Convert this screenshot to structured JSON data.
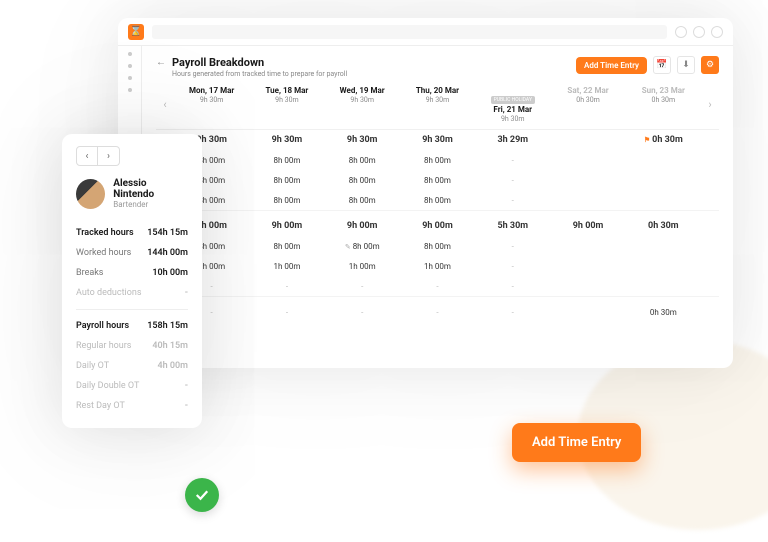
{
  "header": {
    "title": "Payroll Breakdown",
    "subtitle": "Hours generated from tracked time to prepare for payroll",
    "addBtn": "Add Time Entry"
  },
  "days": [
    {
      "label": "Mon, 17 Mar",
      "total": "9h 30m"
    },
    {
      "label": "Tue, 18 Mar",
      "total": "9h 30m"
    },
    {
      "label": "Wed, 19 Mar",
      "total": "9h 30m"
    },
    {
      "label": "Thu, 20 Mar",
      "total": "9h 30m"
    },
    {
      "label": "Fri, 21 Mar",
      "total": "9h 30m",
      "chip": "PUBLIC HOLIDAY"
    },
    {
      "label": "Sat, 22 Mar",
      "total": "0h 30m",
      "wend": true
    },
    {
      "label": "Sun, 23 Mar",
      "total": "0h 30m",
      "wend": true
    }
  ],
  "rows": [
    {
      "bold": true,
      "c": [
        "9h 30m",
        "9h 30m",
        "9h 30m",
        "9h 30m",
        "3h 29m",
        "",
        "0h 30m"
      ],
      "icon": [
        false,
        false,
        false,
        false,
        false,
        false,
        true
      ]
    },
    {
      "c": [
        "8h 00m",
        "8h 00m",
        "8h 00m",
        "8h 00m",
        "-",
        "",
        ""
      ]
    },
    {
      "c": [
        "8h 00m",
        "8h 00m",
        "8h 00m",
        "8h 00m",
        "-",
        "",
        ""
      ]
    },
    {
      "c": [
        "8h 00m",
        "8h 00m",
        "8h 00m",
        "8h 00m",
        "-",
        "",
        ""
      ]
    },
    {
      "sep": true
    },
    {
      "bold": true,
      "c": [
        "9h 00m",
        "9h 00m",
        "9h 00m",
        "9h 00m",
        "5h 30m",
        "9h 00m",
        "0h 30m"
      ]
    },
    {
      "c": [
        "8h 00m",
        "8h 00m",
        "8h 00m",
        "8h 00m",
        "-",
        "",
        ""
      ],
      "pen": [
        false,
        false,
        true,
        false,
        false,
        false,
        false
      ]
    },
    {
      "c": [
        "1h 00m",
        "1h 00m",
        "1h 00m",
        "1h 00m",
        "-",
        "",
        ""
      ]
    },
    {
      "c": [
        "-",
        "-",
        "-",
        "-",
        "-",
        "",
        ""
      ]
    },
    {
      "sep": true
    },
    {
      "c": [
        "-",
        "-",
        "-",
        "-",
        "-",
        "",
        "0h 30m"
      ]
    }
  ],
  "emp": {
    "name": "Alessio Nintendo",
    "role": "Bartender"
  },
  "stats": [
    {
      "l": "Tracked hours",
      "v": "154h 15m",
      "maj": true
    },
    {
      "l": "Worked hours",
      "v": "144h 00m"
    },
    {
      "l": "Breaks",
      "v": "10h 00m"
    },
    {
      "l": "Auto deductions",
      "v": "-",
      "soft": true
    },
    {
      "hr": true
    },
    {
      "l": "Payroll hours",
      "v": "158h 15m",
      "maj": true
    },
    {
      "l": "Regular hours",
      "v": "40h 15m",
      "soft": true
    },
    {
      "l": "Daily OT",
      "v": "4h 00m",
      "soft": true
    },
    {
      "l": "Daily Double OT",
      "v": "-",
      "soft": true
    },
    {
      "l": "Rest Day OT",
      "v": "-",
      "soft": true
    }
  ],
  "float": "Add Time Entry",
  "icons": {
    "back": "←",
    "prev": "‹",
    "next": "›",
    "cal": "📅",
    "dl": "⬇",
    "gear": "⚙"
  }
}
